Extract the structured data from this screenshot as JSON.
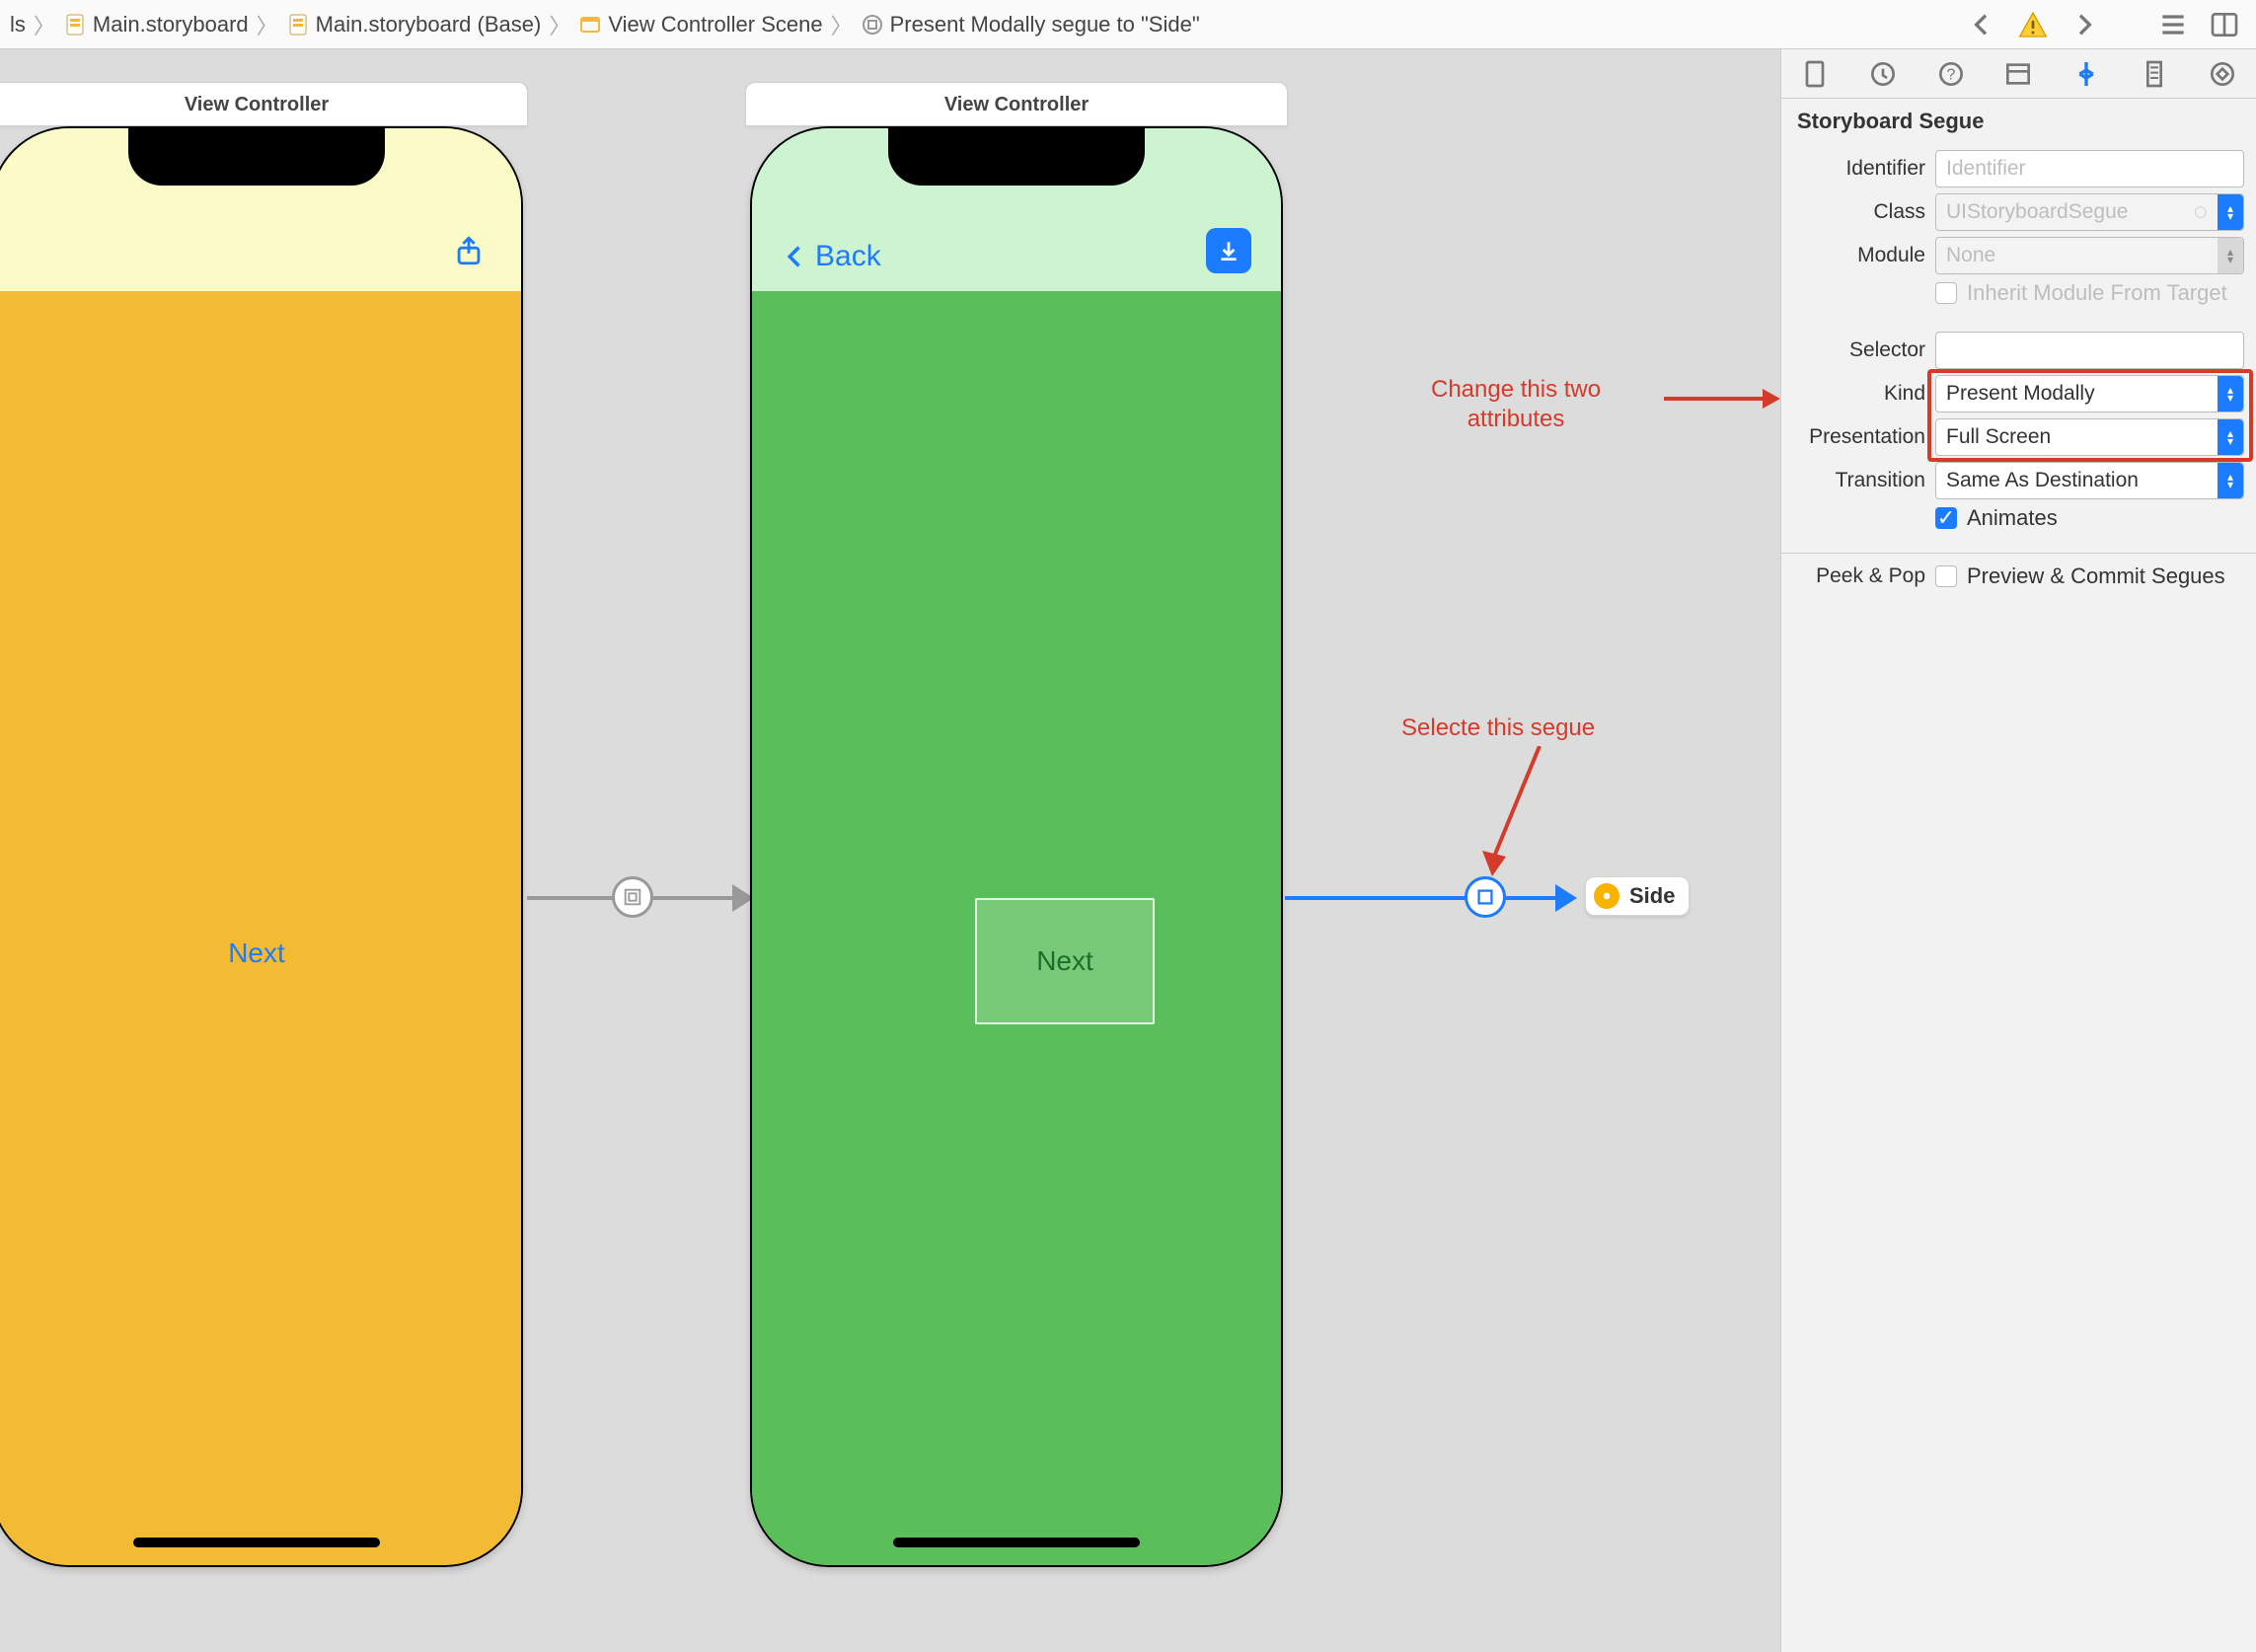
{
  "crumbs": {
    "c0": "ls",
    "c1": "Main.storyboard",
    "c2": "Main.storyboard (Base)",
    "c3": "View Controller Scene",
    "c4": "Present Modally segue to \"Side\""
  },
  "canvas": {
    "vc_title": "View Controller",
    "next_btn": "Next",
    "back_label": "Back",
    "side_chip": "Side"
  },
  "annotations": {
    "attrs": "Change this two\nattributes",
    "segue": "Selecte this segue"
  },
  "inspector": {
    "section": "Storyboard Segue",
    "labels": {
      "identifier": "Identifier",
      "cls": "Class",
      "module": "Module",
      "inherit": "Inherit Module From Target",
      "selector": "Selector",
      "kind": "Kind",
      "presentation": "Presentation",
      "transition": "Transition",
      "animates": "Animates",
      "peekpop": "Peek & Pop",
      "preview": "Preview & Commit Segues"
    },
    "values": {
      "identifier_ph": "Identifier",
      "cls_ph": "UIStoryboardSegue",
      "module_ph": "None",
      "kind": "Present Modally",
      "presentation": "Full Screen",
      "transition": "Same As Destination"
    }
  }
}
